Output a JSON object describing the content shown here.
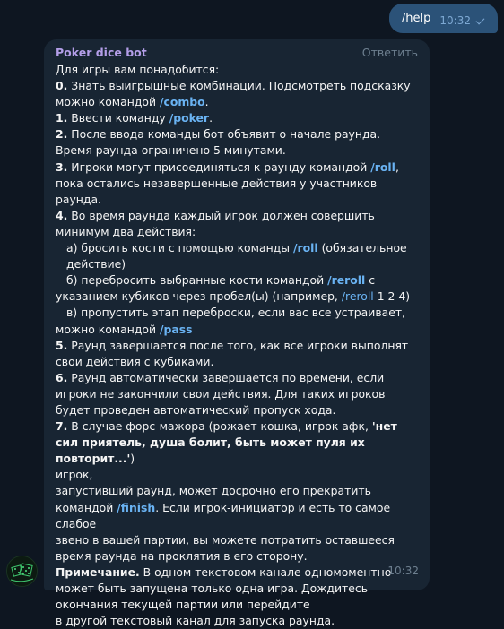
{
  "outgoing": {
    "text": "/help",
    "time": "10:32"
  },
  "incoming": {
    "sender": "Poker dice bot",
    "reply_label": "Ответить",
    "time": "10:32",
    "intro": "Для игры вам понадобится:",
    "l0_num": "0.",
    "l0_text": "Знать выигрышные комбинации. Подсмотреть подсказку можно командой",
    "l0_cmd": "/combo",
    "l0_end": ".",
    "l1_num": "1.",
    "l1_text": "Ввести команду",
    "l1_cmd": "/poker",
    "l1_end": ".",
    "l2_num": "2.",
    "l2_text": "После ввода команды бот объявит о начале раунда. Время раунда ограничено 5 минутами.",
    "l3_num": "3.",
    "l3_text": "Игроки могут присоединяться к раунду командой",
    "l3_cmd": "/roll",
    "l3_end": ", пока остались незавершенные действия у участников раунда.",
    "l4_num": "4.",
    "l4_text": "Во время раунда каждый игрок должен совершить минимум два действия:",
    "l4a_text": "а) бросить кости с помощью команды",
    "l4a_cmd": "/roll",
    "l4a_end": "(обязательное действие)",
    "l4b_text": "б) перебросить выбранные кости командой",
    "l4b_cmd": "/reroll",
    "l4b_mid": "с указанием кубиков через пробел(ы) (например,",
    "l4b_cmd2": "/reroll",
    "l4b_end": "1 2 4)",
    "l4c_text": "в) пропустить этап переброски, если вас все устраивает, можно командой",
    "l4c_cmd": "/pass",
    "l5_num": "5.",
    "l5_text": "Раунд завершается после того, как все игроки выполнят свои действия с кубиками.",
    "l6_num": "6.",
    "l6_text": "Раунд автоматически завершается по времени, если игроки не закончили свои действия. Для таких игроков будет проведен автоматический пропуск хода.",
    "l7_num": "7.",
    "l7_text": "В случае форс-мажора (рожает кошка, игрок афк,",
    "l7_bold": "'нет сил приятель, душа болит, быть может пуля их повторит...'",
    "l7_close": ")",
    "l7_line2": "игрок,",
    "l7_line3": "запустивший раунд, может досрочно его прекратить командой",
    "l7_cmd": "/finish",
    "l7_line3b": ". Если игрок-инициатор и есть то самое слабое",
    "l7_line4": "звено в вашей партии, вы можете потратить оставшееся время раунда на проклятия в его сторону.",
    "note_label": "Примечание.",
    "note_text": "В одном текстовом канале одномоментно может быть запущена только одна игра. Дождитесь окончания текущей партии или перейдите",
    "note_line2": "в другой текстовый канал для запуска раунда."
  },
  "colors": {
    "background": "#0e1621",
    "outgoing_bubble": "#2b5278",
    "incoming_bubble": "#182533",
    "link": "#6ab3f3",
    "sender": "#b39ee8"
  },
  "icons": [
    "double-check-icon",
    "bot-avatar-icon"
  ]
}
